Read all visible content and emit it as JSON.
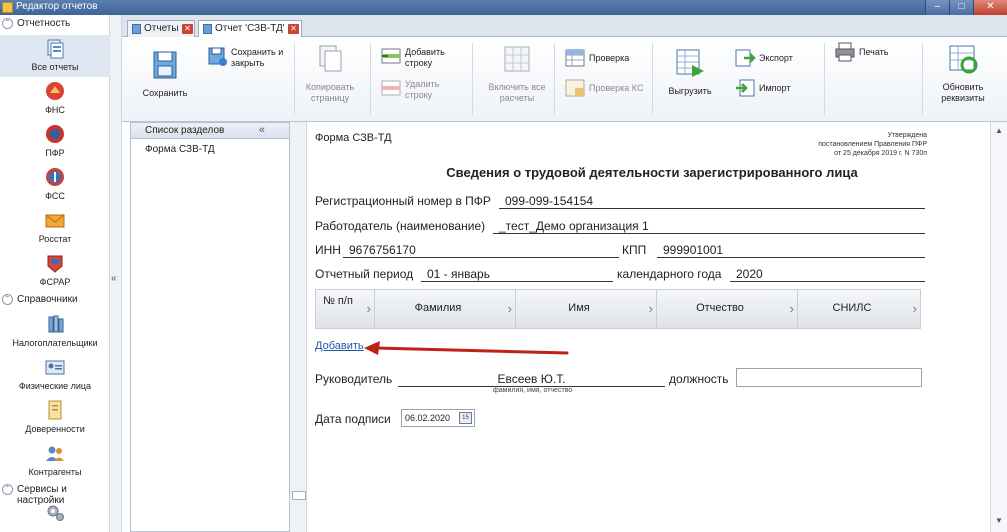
{
  "window": {
    "title": "Редактор отчетов"
  },
  "nav": {
    "groups": [
      {
        "label": "Отчетность"
      },
      {
        "label": "Справочники"
      },
      {
        "label": "Сервисы и настройки"
      }
    ],
    "reports": [
      {
        "label": "Все отчеты"
      },
      {
        "label": "ФНС"
      },
      {
        "label": "ПФР"
      },
      {
        "label": "ФСС"
      },
      {
        "label": "Росстат"
      },
      {
        "label": "ФСРАР"
      }
    ],
    "directories": [
      {
        "label": "Налогоплательщики"
      },
      {
        "label": "Физические лица"
      },
      {
        "label": "Доверенности"
      },
      {
        "label": "Контрагенты"
      }
    ]
  },
  "tabs": [
    {
      "label": "Отчеты"
    },
    {
      "label": "Отчет 'СЗВ-ТД'"
    }
  ],
  "ribbon": {
    "save": "Сохранить",
    "save_close": [
      "Сохранить и",
      "закрыть"
    ],
    "copy_page": [
      "Копировать",
      "страницу"
    ],
    "add_row": [
      "Добавить",
      "строку"
    ],
    "delete_row": [
      "Удалить",
      "строку"
    ],
    "include_all": [
      "Включить все",
      "расчеты"
    ],
    "check": "Проверка",
    "check_ks": "Проверка КС",
    "upload": "Выгрузить",
    "export": "Экспорт",
    "import": "Импорт",
    "print": "Печать",
    "refresh_req": [
      "Обновить",
      "реквизиты"
    ]
  },
  "sections": {
    "header": "Список разделов",
    "items": [
      "Форма СЗВ-ТД"
    ]
  },
  "form": {
    "form_name": "Форма СЗВ-ТД",
    "approved": [
      "Утверждена",
      "постановлением Правления ПФР",
      "от 25 декабря 2019 г. N 730п"
    ],
    "title": "Сведения о трудовой деятельности зарегистрированного лица",
    "reg_label": "Регистрационный номер в ПФР",
    "reg_value": "099-099-154154",
    "employer_label": "Работодатель (наименование)",
    "employer_value": "_тест_Демо организация 1",
    "inn_label": "ИНН",
    "inn_value": "9676756170",
    "kpp_label": "КПП",
    "kpp_value": "999901001",
    "period_label": "Отчетный период",
    "period_value": "01 - январь",
    "year_label": "календарного года",
    "year_value": "2020",
    "columns": [
      "№ п/п",
      "Фамилия",
      "Имя",
      "Отчество",
      "СНИЛС"
    ],
    "add_link": "Добавить",
    "head_label": "Руководитель",
    "head_value": "Евсеев Ю.Т.",
    "head_caption": "фамилия, имя, отчество",
    "position_label": "должность",
    "position_value": "",
    "sign_date_label": "Дата подписи",
    "sign_date_value": "06.02.2020",
    "calendar_day": "15"
  },
  "colors": {
    "titlebar": "#3e6498",
    "link": "#1a55a6",
    "arrow": "#c0201a"
  }
}
